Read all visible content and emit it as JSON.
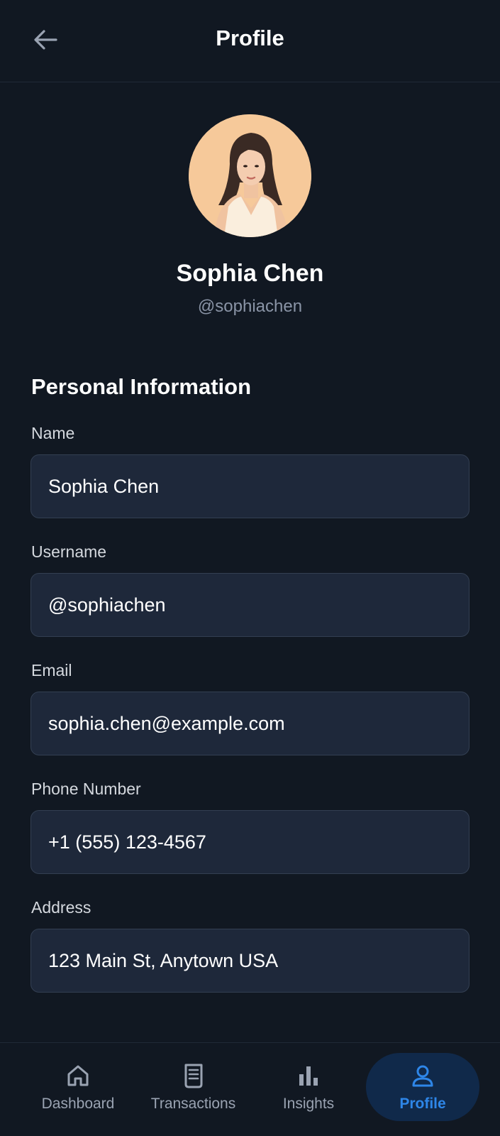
{
  "header": {
    "title": "Profile",
    "back_icon": "arrow-left-icon"
  },
  "profile": {
    "name": "Sophia Chen",
    "handle": "@sophiachen",
    "avatar_icon": "avatar-illustration"
  },
  "section": {
    "title": "Personal Information"
  },
  "fields": [
    {
      "label": "Name",
      "value": "Sophia Chen"
    },
    {
      "label": "Username",
      "value": "@sophiachen"
    },
    {
      "label": "Email",
      "value": "sophia.chen@example.com"
    },
    {
      "label": "Phone Number",
      "value": "+1 (555) 123-4567"
    },
    {
      "label": "Address",
      "value": "123 Main St, Anytown USA"
    }
  ],
  "nav": [
    {
      "label": "Dashboard",
      "icon": "home-icon",
      "active": false
    },
    {
      "label": "Transactions",
      "icon": "receipt-icon",
      "active": false
    },
    {
      "label": "Insights",
      "icon": "bar-chart-icon",
      "active": false
    },
    {
      "label": "Profile",
      "icon": "user-icon",
      "active": true
    }
  ],
  "colors": {
    "background": "#111822",
    "input_bg": "#1e283a",
    "accent": "#2e86e8",
    "active_nav_bg": "#10294a",
    "muted_text": "#8a94a6"
  }
}
